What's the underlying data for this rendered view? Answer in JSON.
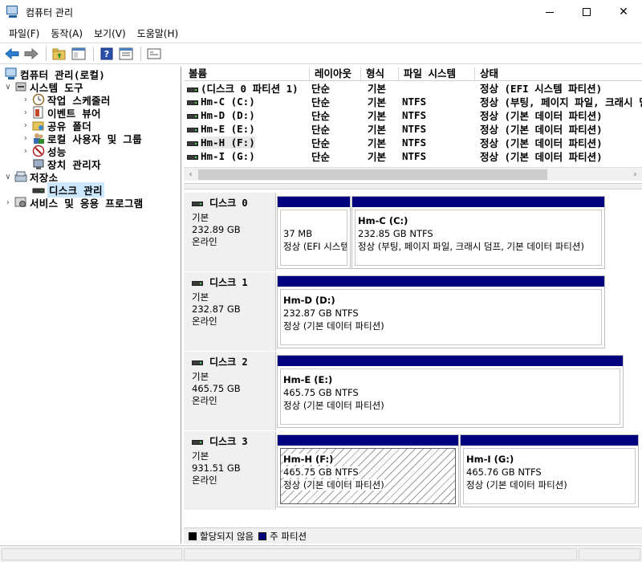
{
  "window": {
    "title": "컴퓨터 관리"
  },
  "menu": [
    "파일(F)",
    "동작(A)",
    "보기(V)",
    "도움말(H)"
  ],
  "toolbar": {
    "buttons": [
      "back-arrow-icon",
      "forward-arrow-icon",
      "folder-up-icon",
      "show-hide-tree-icon",
      "help-icon",
      "properties-icon",
      "console-icon"
    ]
  },
  "tree": {
    "items": [
      {
        "label": "컴퓨터 관리(로컬)",
        "icon": "computer-management-icon",
        "level": 0,
        "expander": ""
      },
      {
        "label": "시스템 도구",
        "icon": "tools-icon",
        "level": 1,
        "expander": "expanded"
      },
      {
        "label": "작업 스케줄러",
        "icon": "clock-icon",
        "level": 2,
        "expander": "collapsed"
      },
      {
        "label": "이벤트 뷰어",
        "icon": "event-viewer-icon",
        "level": 2,
        "expander": "collapsed"
      },
      {
        "label": "공유 폴더",
        "icon": "shared-folder-icon",
        "level": 2,
        "expander": "collapsed"
      },
      {
        "label": "로컬 사용자 및 그룹",
        "icon": "users-icon",
        "level": 2,
        "expander": "collapsed"
      },
      {
        "label": "성능",
        "icon": "performance-icon",
        "level": 2,
        "expander": "collapsed"
      },
      {
        "label": "장치 관리자",
        "icon": "device-manager-icon",
        "level": 2,
        "expander": ""
      },
      {
        "label": "저장소",
        "icon": "storage-icon",
        "level": 1,
        "expander": "expanded"
      },
      {
        "label": "디스크 관리",
        "icon": "disk-management-icon",
        "level": 2,
        "expander": "",
        "selected": true
      },
      {
        "label": "서비스 및 응용 프로그램",
        "icon": "services-icon",
        "level": 1,
        "expander": "collapsed"
      }
    ]
  },
  "volumes": {
    "headers": [
      "볼륨",
      "레이아웃",
      "형식",
      "파일 시스템",
      "상태"
    ],
    "rows": [
      {
        "volume": "(디스크 0 파티션 1)",
        "layout": "단순",
        "type": "기본",
        "fs": "",
        "status": "정상 (EFI 시스템 파티션)"
      },
      {
        "volume": "Hm-C (C:)",
        "layout": "단순",
        "type": "기본",
        "fs": "NTFS",
        "status": "정상 (부팅, 페이지 파일, 크래시 덤프, 기본 데이터 파티션)"
      },
      {
        "volume": "Hm-D (D:)",
        "layout": "단순",
        "type": "기본",
        "fs": "NTFS",
        "status": "정상 (기본 데이터 파티션)"
      },
      {
        "volume": "Hm-E (E:)",
        "layout": "단순",
        "type": "기본",
        "fs": "NTFS",
        "status": "정상 (기본 데이터 파티션)"
      },
      {
        "volume": "Hm-H (F:)",
        "layout": "단순",
        "type": "기본",
        "fs": "NTFS",
        "status": "정상 (기본 데이터 파티션)"
      },
      {
        "volume": "Hm-I (G:)",
        "layout": "단순",
        "type": "기본",
        "fs": "NTFS",
        "status": "정상 (기본 데이터 파티션)"
      }
    ]
  },
  "disks": [
    {
      "name": "디스크 0",
      "type": "기본",
      "size": "232.89 GB",
      "state": "온라인",
      "partitions": [
        {
          "name": "",
          "size": "37 MB",
          "status": "정상 (EFI 시스템 파티션)"
        },
        {
          "name": "Hm-C  (C:)",
          "size": "232.85 GB NTFS",
          "status": "정상 (부팅, 페이지 파일, 크래시 덤프, 기본 데이터 파티션)"
        }
      ]
    },
    {
      "name": "디스크 1",
      "type": "기본",
      "size": "232.87 GB",
      "state": "온라인",
      "partitions": [
        {
          "name": "Hm-D  (D:)",
          "size": "232.87 GB NTFS",
          "status": "정상 (기본 데이터 파티션)"
        }
      ]
    },
    {
      "name": "디스크 2",
      "type": "기본",
      "size": "465.75 GB",
      "state": "온라인",
      "partitions": [
        {
          "name": "Hm-E  (E:)",
          "size": "465.75 GB NTFS",
          "status": "정상 (기본 데이터 파티션)"
        }
      ]
    },
    {
      "name": "디스크 3",
      "type": "기본",
      "size": "931.51 GB",
      "state": "온라인",
      "partitions": [
        {
          "name": "Hm-H  (F:)",
          "size": "465.75 GB NTFS",
          "status": "정상 (기본 데이터 파티션)",
          "selected": true
        },
        {
          "name": "Hm-I  (G:)",
          "size": "465.76 GB NTFS",
          "status": "정상 (기본 데이터 파티션)"
        }
      ]
    }
  ],
  "legend": [
    {
      "label": "할당되지 않음",
      "color": "#000000"
    },
    {
      "label": "주 파티션",
      "color": "#00007f"
    }
  ],
  "colors": {
    "primary_partition": "#00007f",
    "selection": "#cce8ff"
  }
}
